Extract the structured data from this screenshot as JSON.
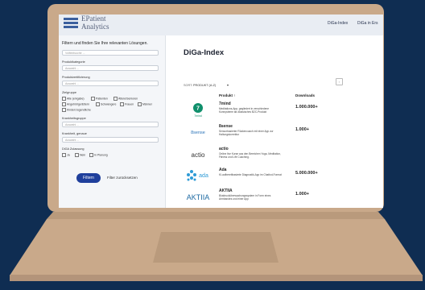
{
  "header": {
    "brand_line1": "EPatient",
    "brand_line2": "Analytics",
    "nav": [
      "DiGa-Index",
      "DiGa in Ers"
    ]
  },
  "sidebar": {
    "title": "Filtern und finden Sie Ihre relevanten Lösungen.",
    "search_placeholder": "Volltextsuche ...",
    "produktkategorie_label": "Produktkategorie",
    "produktkategorie_value": "Auswahl ...",
    "produktzertifizierung_label": "Produktzertifizierung",
    "produktzertifizierung_value": "Auswahl ...",
    "zielgruppe_label": "Zielgruppe",
    "zielgruppe_options": [
      "Alle (eingabe)",
      "Patienten",
      "Ältere/Senioren",
      "Angehörige/Eltern",
      "Schwangere",
      "Frauen",
      "Männer",
      "Kinder/Jugendliche"
    ],
    "krankheitsgruppe_label": "Krankheitsgruppe",
    "krankheitsgruppe_value": "Auswahl ...",
    "krankheit_label": "Krankheit, genaue",
    "krankheit_value": "Auswahl ...",
    "diga_label": "DiGA Zulassung",
    "diga_options": [
      "Ja",
      "Nein",
      "In Planung"
    ],
    "filter_button": "Filtern",
    "reset_button": "Filter zurücksetzen"
  },
  "main": {
    "heading": "DiGa-Index",
    "sort_label": "SORT:",
    "sort_value": "PRODUKT (A-Z)",
    "col_product": "Produkt ↑",
    "col_downloads": "Downloads",
    "products": [
      {
        "logo": "7mind",
        "name": "7mind",
        "desc": "Meditations-App, gegliedert in verschiedene Kursrysteme als klassisches B2C-Produkt",
        "downloads": "1.000.000+"
      },
      {
        "logo": "8sense",
        "name": "8sense",
        "desc": "Sensorbasierter Rückencoach mit einer App zur Haltungskorrektur",
        "downloads": "1.000+"
      },
      {
        "logo": "actio",
        "name": "actio",
        "desc": "Online live Kurse aus den Bereichen Yoga, Meditation, Fitness und Life Coaching.",
        "downloads": ""
      },
      {
        "logo": "ada",
        "name": "Ada",
        "desc": "KI-aufbereitbasierte Diagnostik-App im Chatbot-Format",
        "downloads": "5.000.000+"
      },
      {
        "logo": "AKTIIA",
        "name": "AKTIIA",
        "desc": "Blutdrucküberwachungssystem in Form eines Armbandes und einer App",
        "downloads": "1.000+"
      }
    ]
  },
  "colors": {
    "background": "#0f2d52",
    "laptop": "#c9a98a",
    "accent_button": "#1f3f9c"
  }
}
